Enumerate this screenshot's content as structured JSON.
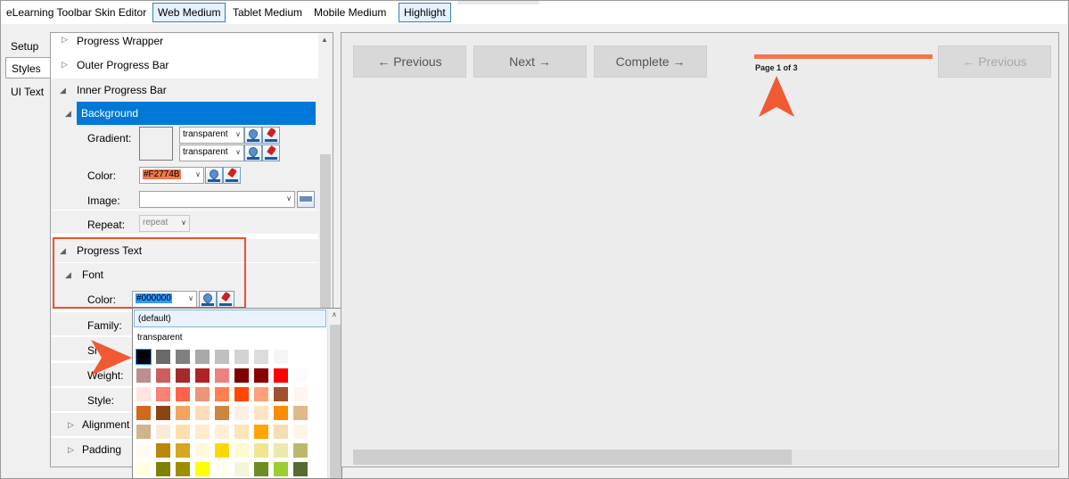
{
  "app": {
    "title": "eLearning Toolbar Skin Editor",
    "tabs": [
      "Web Medium",
      "Tablet Medium",
      "Mobile Medium",
      "Highlight"
    ]
  },
  "side_tabs": [
    "Setup",
    "Styles",
    "UI Text"
  ],
  "tree": {
    "progress_wrapper": "Progress Wrapper",
    "outer_progress_bar": "Outer Progress Bar",
    "inner_progress_bar": "Inner Progress Bar",
    "background": "Background",
    "gradient_label": "Gradient:",
    "gradient_1": "transparent",
    "gradient_2": "transparent",
    "color_label": "Color:",
    "color_value": "#F2774B",
    "image_label": "Image:",
    "image_value": "",
    "repeat_label": "Repeat:",
    "repeat_value": "repeat",
    "progress_text": "Progress Text",
    "font": "Font",
    "font_color_label": "Color:",
    "font_color_value": "#000000",
    "family_label": "Family:",
    "size_label": "Si",
    "weight_label": "Weight:",
    "style_label": "Style:",
    "alignment": "Alignment",
    "padding": "Padding"
  },
  "palette": {
    "default_option": "(default)",
    "transparent_option": "transparent",
    "rows": [
      [
        "#000000",
        "#696969",
        "#808080",
        "#a9a9a9",
        "#c0c0c0",
        "#d3d3d3",
        "#dcdcdc",
        "#f5f5f5",
        "#ffffff"
      ],
      [
        "#bc8f8f",
        "#cd5c5c",
        "#a52a2a",
        "#b22222",
        "#f08080",
        "#800000",
        "#8b0000",
        "#ff0000",
        "#fffafa"
      ],
      [
        "#ffe4e1",
        "#fa8072",
        "#ff6347",
        "#e9967a",
        "#ff7f50",
        "#ff4500",
        "#ffa07a",
        "#a0522d",
        "#fff5ee"
      ],
      [
        "#d2691e",
        "#8b4513",
        "#f4a460",
        "#ffdab9",
        "#cd853f",
        "#faf0e6",
        "#ffe4c4",
        "#ff8c00",
        "#deb887"
      ],
      [
        "#d2b48c",
        "#faebd7",
        "#ffdead",
        "#ffebcd",
        "#ffefd5",
        "#ffe4b5",
        "#ffa500",
        "#f5deb3",
        "#fdf5e6"
      ],
      [
        "#fffaf0",
        "#b8860b",
        "#daa520",
        "#fff8dc",
        "#ffd700",
        "#fffacd",
        "#f0e68c",
        "#eee8aa",
        "#bdb76b"
      ],
      [
        "#ffffe0",
        "#808000",
        "#9b8f00",
        "#ffff00",
        "#fffff0",
        "#f5f5dc",
        "#6b8e23",
        "#9acd32",
        "#556b2f"
      ]
    ]
  },
  "preview": {
    "buttons": [
      {
        "label": "← Previous",
        "disabled": false
      },
      {
        "label": "Next →",
        "disabled": false
      },
      {
        "label": "Complete →",
        "disabled": false
      },
      {
        "label": "← Previous",
        "disabled": true
      }
    ],
    "page_text": "Page 1 of 3",
    "progress_color": "#f2774b"
  },
  "colors": {
    "selection": "#0078d7",
    "annotation": "#e8532f"
  }
}
